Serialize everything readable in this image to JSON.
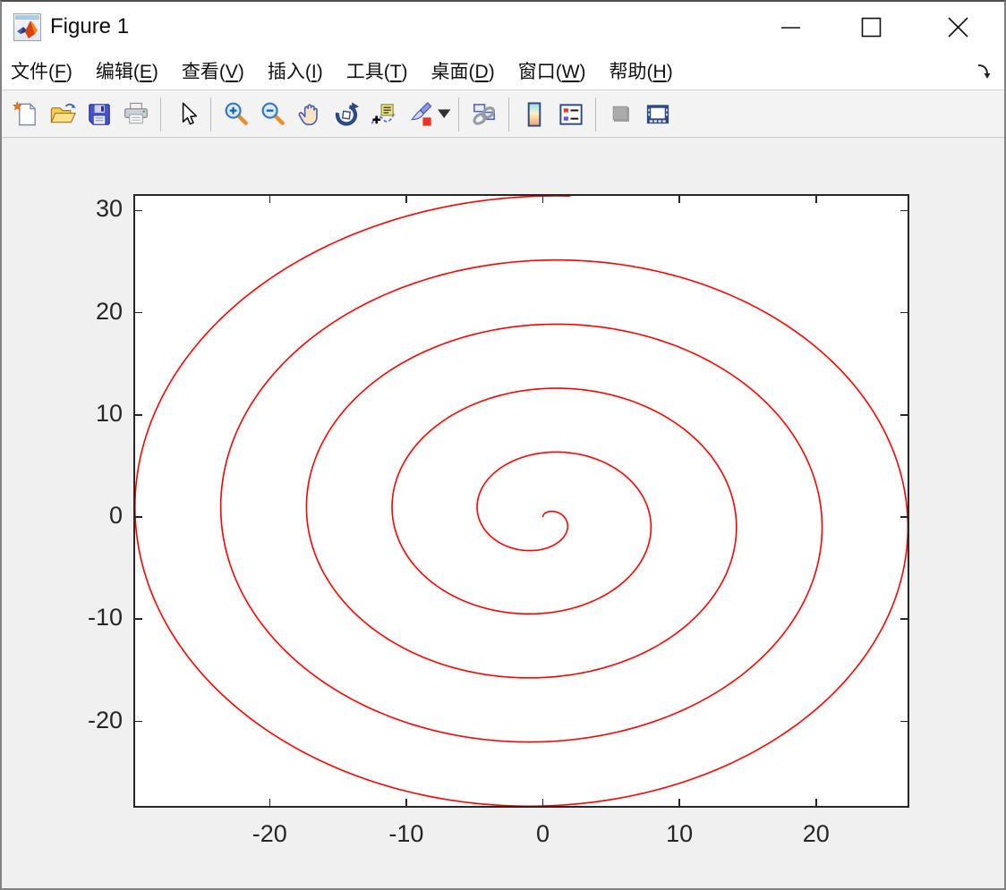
{
  "window": {
    "title": "Figure 1",
    "controls": [
      "minimize",
      "maximize",
      "close"
    ],
    "app_icon": "matlab-figure-icon"
  },
  "menubar": {
    "items": [
      {
        "key": "file",
        "text": "文件",
        "mnemonic": "F"
      },
      {
        "key": "edit",
        "text": "编辑",
        "mnemonic": "E"
      },
      {
        "key": "view",
        "text": "查看",
        "mnemonic": "V"
      },
      {
        "key": "insert",
        "text": "插入",
        "mnemonic": "I"
      },
      {
        "key": "tools",
        "text": "工具",
        "mnemonic": "T"
      },
      {
        "key": "desktop",
        "text": "桌面",
        "mnemonic": "D"
      },
      {
        "key": "window",
        "text": "窗口",
        "mnemonic": "W"
      },
      {
        "key": "help",
        "text": "帮助",
        "mnemonic": "H"
      }
    ],
    "dock_icon": "dock-figure-arrow"
  },
  "toolbar": {
    "items": [
      "new-figure",
      "open-file",
      "save-figure",
      "print-figure",
      "|",
      "edit-plot-pointer",
      "|",
      "zoom-in",
      "zoom-out",
      "pan",
      "rotate-3d",
      "data-cursor",
      "brush-data",
      "brush-dropdown",
      "|",
      "link-plot",
      "|",
      "insert-colorbar",
      "insert-legend",
      "|",
      "hide-plot-tools",
      "show-plot-tools-dock"
    ],
    "disabled_items": [
      "hide-plot-tools"
    ]
  },
  "chart_data": {
    "type": "line",
    "title": "",
    "xlabel": "",
    "ylabel": "",
    "description": "Archimedean spiral, clockwise from +y axis",
    "parametric": {
      "x": "t*sin(t)",
      "y": "t*cos(t)",
      "t_min": 0,
      "t_max": 31.48,
      "samples": 2000
    },
    "series": [
      {
        "name": "spiral",
        "color": "#ff0000",
        "line_width": 1.6
      }
    ],
    "xlim": [
      -29.85,
      26.7
    ],
    "ylim": [
      -28.27,
      31.43
    ],
    "xticks": [
      -20,
      -10,
      0,
      10,
      20
    ],
    "yticks": [
      -20,
      -10,
      0,
      10,
      20,
      30
    ],
    "grid": false,
    "box": true,
    "tick_dir": "in",
    "tick_len": 8,
    "axis_color": "#262626",
    "plot_bg": "#ffffff",
    "figure_bg": "#f0f0f0",
    "legend": null
  }
}
